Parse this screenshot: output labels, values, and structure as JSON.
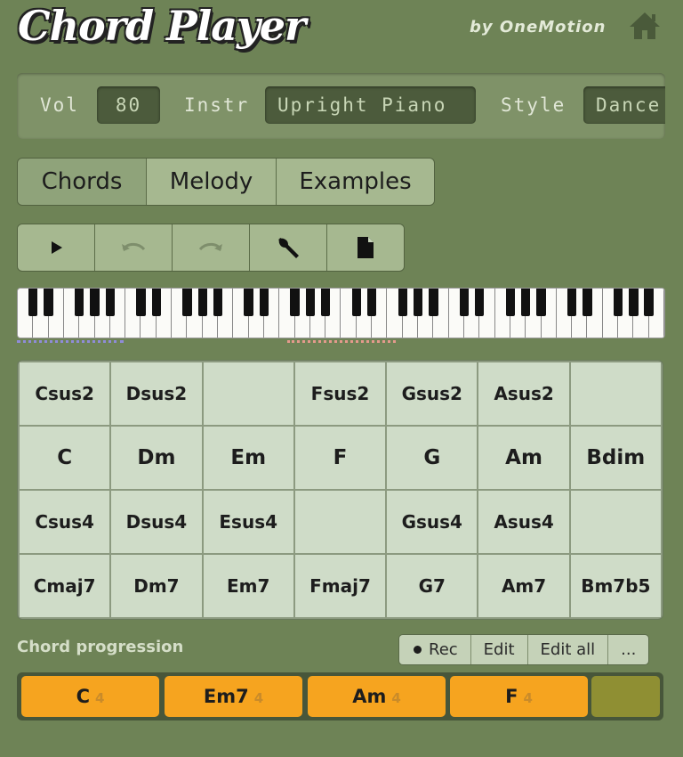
{
  "app": {
    "title": "Chord Player",
    "byline": "by OneMotion"
  },
  "settings": {
    "vol_label": "Vol",
    "vol_value": "80",
    "instr_label": "Instr",
    "instr_value": "Upright Piano",
    "style_label": "Style",
    "style_value": "Dance"
  },
  "tabs": [
    {
      "label": "Chords",
      "active": true
    },
    {
      "label": "Melody",
      "active": false
    },
    {
      "label": "Examples",
      "active": false
    }
  ],
  "toolbar": [
    {
      "icon": "play-icon",
      "enabled": true
    },
    {
      "icon": "undo-icon",
      "enabled": false
    },
    {
      "icon": "redo-icon",
      "enabled": false
    },
    {
      "icon": "wrench-icon",
      "enabled": true
    },
    {
      "icon": "document-icon",
      "enabled": true
    }
  ],
  "chord_grid": [
    [
      "Csus2",
      "Dsus2",
      "",
      "Fsus2",
      "Gsus2",
      "Asus2",
      ""
    ],
    [
      "C",
      "Dm",
      "Em",
      "F",
      "G",
      "Am",
      "Bdim"
    ],
    [
      "Csus4",
      "Dsus4",
      "Esus4",
      "",
      "Gsus4",
      "Asus4",
      ""
    ],
    [
      "Cmaj7",
      "Dm7",
      "Em7",
      "Fmaj7",
      "G7",
      "Am7",
      "Bm7b5"
    ]
  ],
  "progression": {
    "label": "Chord progression",
    "buttons": {
      "rec": "Rec",
      "edit": "Edit",
      "edit_all": "Edit all",
      "more": "..."
    },
    "chords": [
      {
        "name": "C",
        "beats": "4"
      },
      {
        "name": "Em7",
        "beats": "4"
      },
      {
        "name": "Am",
        "beats": "4"
      },
      {
        "name": "F",
        "beats": "4"
      }
    ]
  },
  "colors": {
    "background": "#6e8356",
    "chord_accent": "#f6a41f",
    "empty_slot": "#8f8f33"
  }
}
